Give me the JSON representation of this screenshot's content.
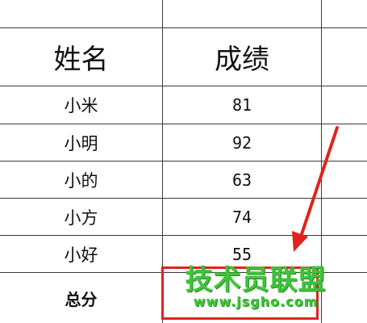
{
  "table": {
    "headers": {
      "name": "姓名",
      "score": "成绩"
    },
    "rows": [
      {
        "name": "小米",
        "score": "81"
      },
      {
        "name": "小明",
        "score": "92"
      },
      {
        "name": "小的",
        "score": "63"
      },
      {
        "name": "小方",
        "score": "74"
      },
      {
        "name": "小好",
        "score": "55"
      }
    ],
    "total_label": "总分",
    "total_value": ""
  },
  "watermark": {
    "title": "技术员联盟",
    "url": "www.jsgho.com"
  },
  "colors": {
    "selection": "#e0231f",
    "watermark": "#3fc33a",
    "grid": "#3a3a3a"
  }
}
